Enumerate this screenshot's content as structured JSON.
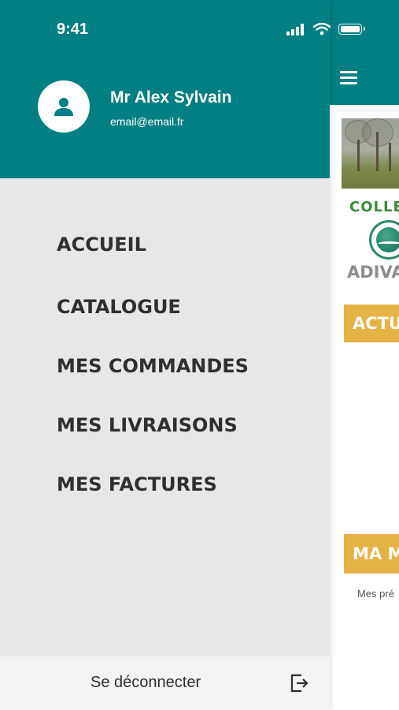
{
  "status_bar": {
    "time": "9:41",
    "icons": [
      "signal-icon",
      "wifi-icon",
      "battery-icon"
    ]
  },
  "user": {
    "name": "Mr Alex Sylvain",
    "email": "email@email.fr",
    "avatar_icon": "person-icon"
  },
  "menu": {
    "items": [
      {
        "label": "ACCUEIL"
      },
      {
        "label": "CATALOGUE"
      },
      {
        "label": "MES COMMANDES"
      },
      {
        "label": "MES LIVRAISONS"
      },
      {
        "label": "MES FACTURES"
      }
    ]
  },
  "logout": {
    "label": "Se déconnecter",
    "icon": "logout-icon"
  },
  "background_page": {
    "menu_icon": "hamburger-icon",
    "collect_text": "COLLE",
    "logo_text": "ADIVA",
    "banner_actu": "ACTU",
    "banner_ma": "MA M",
    "small_text": "Mes pré"
  },
  "colors": {
    "primary": "#017f82",
    "drawer_bg": "#e7e7e7",
    "accent": "#e5b246",
    "text_dark": "#2f2f2f"
  }
}
